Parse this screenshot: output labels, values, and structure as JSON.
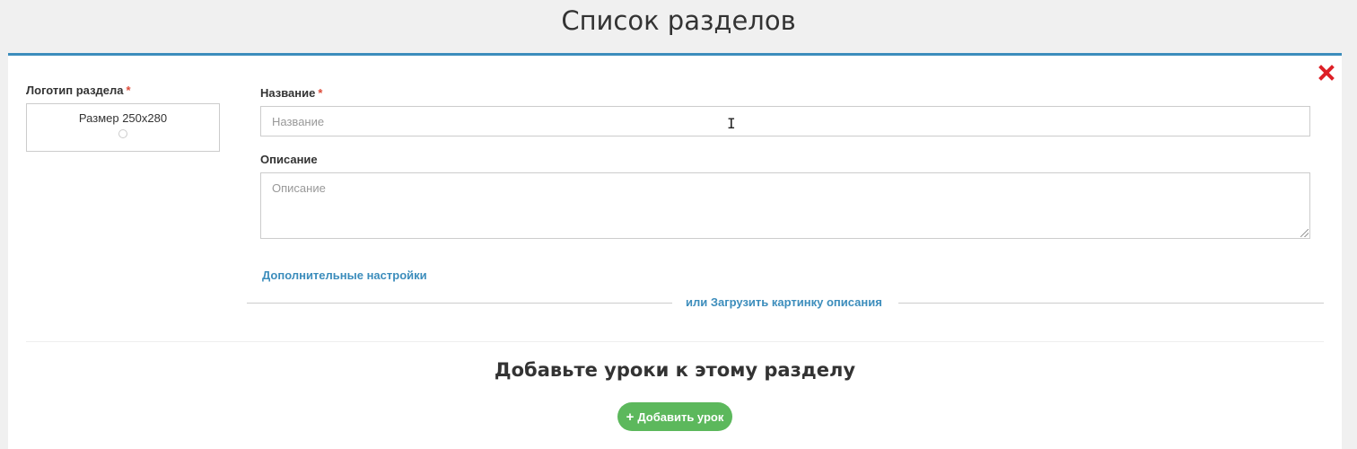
{
  "page": {
    "title": "Список разделов"
  },
  "form": {
    "logo": {
      "label": "Логотип раздела",
      "required_mark": "*",
      "size_hint": "Размер 250x280"
    },
    "name": {
      "label": "Название",
      "required_mark": "*",
      "placeholder": "Название",
      "value": ""
    },
    "description": {
      "label": "Описание",
      "placeholder": "Описание",
      "value": ""
    },
    "advanced_settings_link": "Дополнительные настройки",
    "upload_image_link": "или Загрузить картинку описания"
  },
  "lessons": {
    "title": "Добавьте уроки к этому разделу",
    "add_button_label": "Добавить урок"
  },
  "icons": {
    "close": "close-icon",
    "plus": "plus-icon",
    "cursor": "text-cursor-icon"
  },
  "colors": {
    "accent": "#3c8dbc",
    "close": "#dd1f26",
    "required": "#dd4b39",
    "success": "#5cb85c"
  }
}
